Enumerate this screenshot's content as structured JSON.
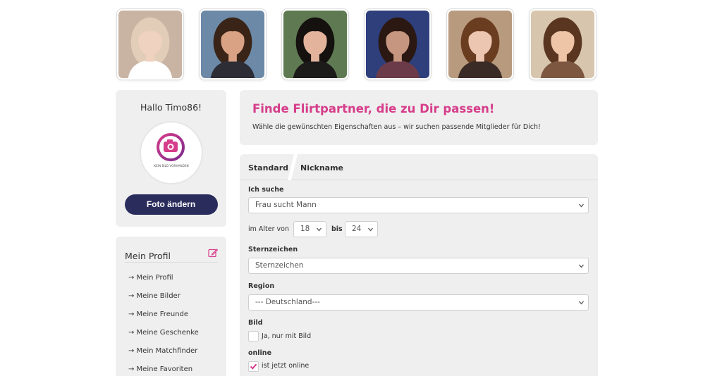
{
  "photos": [
    {
      "name": "member-photo-1",
      "bg": "#c9b3a2",
      "hair": "#e2cdb8",
      "skin": "#f0d2c0",
      "shirt": "#ffffff"
    },
    {
      "name": "member-photo-2",
      "bg": "#6c8aa8",
      "hair": "#3a2418",
      "skin": "#d9a285",
      "shirt": "#2d2d36"
    },
    {
      "name": "member-photo-3",
      "bg": "#5f7a52",
      "hair": "#15110f",
      "skin": "#e3b49b",
      "shirt": "#1d1a1a"
    },
    {
      "name": "member-photo-4",
      "bg": "#2e3f7c",
      "hair": "#2b1812",
      "skin": "#c79680",
      "shirt": "#6b3b4a"
    },
    {
      "name": "member-photo-5",
      "bg": "#b89a7e",
      "hair": "#6a3c20",
      "skin": "#ecc6b0",
      "shirt": "#3b2b26"
    },
    {
      "name": "member-photo-6",
      "bg": "#d7c6ad",
      "hair": "#5a3621",
      "skin": "#efc5a8",
      "shirt": "#7d5740"
    }
  ],
  "sidebar": {
    "greeting": "Hallo Timo86!",
    "avatar_caption": "KEIN BILD VORHANDEN",
    "photo_button": "Foto ändern",
    "profile_title": "Mein Profil",
    "menu": [
      "→ Mein Profil",
      "→ Meine Bilder",
      "→ Meine Freunde",
      "→ Meine Geschenke",
      "→ Mein Matchfinder",
      "→ Meine Favoriten"
    ]
  },
  "intro": {
    "title": "Finde Flirtpartner, die zu Dir passen!",
    "subtitle": "Wähle die gewünschten Eigenschaften aus – wir suchen passende Mitglieder für Dich!"
  },
  "search": {
    "tabs": [
      "Standard",
      "Nickname"
    ],
    "ich_suche_label": "Ich suche",
    "ich_suche_value": "Frau sucht Mann",
    "age_label": "im Alter von",
    "age_from": "18",
    "age_to_label": "bis",
    "age_to": "24",
    "zodiac_label": "Sternzeichen",
    "zodiac_value": "Sternzeichen",
    "region_label": "Region",
    "region_value": "--- Deutschland---",
    "bild_label": "Bild",
    "bild_option": "Ja, nur mit Bild",
    "bild_checked": false,
    "online_label": "online",
    "online_option": "ist jetzt online",
    "online_checked": true
  },
  "colors": {
    "accent": "#d63d8a",
    "button": "#2a2d5c",
    "panel": "#efefef"
  }
}
